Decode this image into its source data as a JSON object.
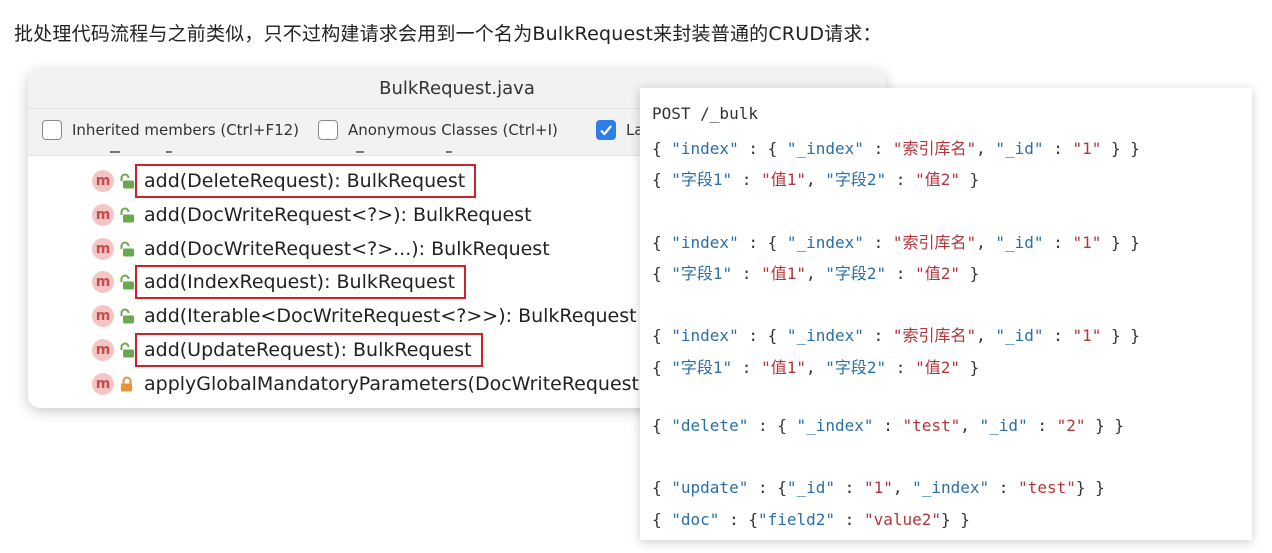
{
  "intro": "批处理代码流程与之前类似，只不过构建请求会用到一个名为BulkRequest来封装普通的CRUD请求：",
  "ide": {
    "title": "BulkRequest.java",
    "options": [
      {
        "label": "Inherited members (Ctrl+F12)",
        "checked": false
      },
      {
        "label": "Anonymous Classes (Ctrl+I)",
        "checked": false
      },
      {
        "label": "La",
        "checked": true
      }
    ],
    "members": [
      {
        "signature": "add(DeleteRequest): BulkRequest",
        "access": "public",
        "highlighted": true
      },
      {
        "signature": "add(DocWriteRequest<?>): BulkRequest",
        "access": "public",
        "highlighted": false
      },
      {
        "signature": "add(DocWriteRequest<?>...): BulkRequest",
        "access": "public",
        "highlighted": false
      },
      {
        "signature": "add(IndexRequest): BulkRequest",
        "access": "public",
        "highlighted": true
      },
      {
        "signature": "add(Iterable<DocWriteRequest<?>>): BulkRequest",
        "access": "public",
        "highlighted": false
      },
      {
        "signature": "add(UpdateRequest): BulkRequest",
        "access": "public",
        "highlighted": true
      },
      {
        "signature": "applyGlobalMandatoryParameters(DocWriteRequest<?",
        "access": "private",
        "highlighted": false
      }
    ],
    "method_badge": "m"
  },
  "code": {
    "lines": [
      "POST /_bulk",
      "{ \"index\" : { \"_index\" : \"索引库名\", \"_id\" : \"1\" } }",
      "{ \"字段1\" : \"值1\", \"字段2\" : \"值2\" }",
      "",
      "{ \"index\" : { \"_index\" : \"索引库名\", \"_id\" : \"1\" } }",
      "{ \"字段1\" : \"值1\", \"字段2\" : \"值2\" }",
      "",
      "{ \"index\" : { \"_index\" : \"索引库名\", \"_id\" : \"1\" } }",
      "{ \"字段1\" : \"值1\", \"字段2\" : \"值2\" }",
      "",
      "{ \"delete\" : { \"_index\" : \"test\", \"_id\" : \"2\" } }",
      "",
      "{ \"update\" : {\"_id\" : \"1\", \"_index\" : \"test\"} }",
      "{ \"doc\" : {\"field2\" : \"value2\"} }"
    ]
  },
  "colors": {
    "highlight": "#d0202a",
    "checkbox_checked": "#2f7ee8",
    "method_badge_bg": "#f3c5c5",
    "lock_public": "#6aa84f",
    "lock_private": "#e8903a",
    "json_key": "#2b6fa6",
    "json_string": "#b0373b"
  }
}
